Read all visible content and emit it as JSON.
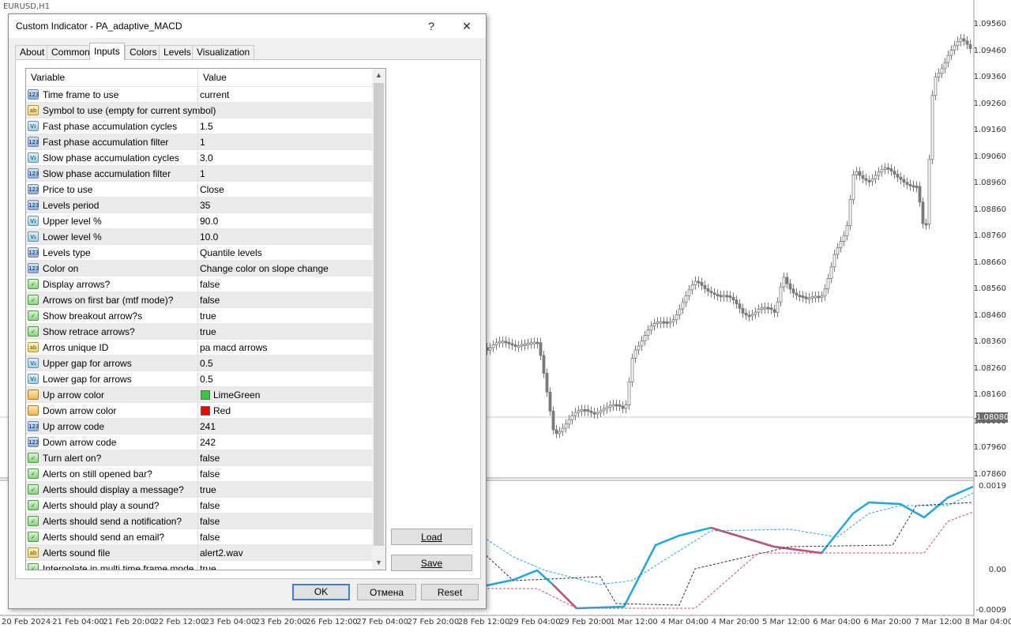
{
  "chart": {
    "symbol_label": "EURUSD,H1",
    "price_labels": [
      "1.09560",
      "1.09460",
      "1.09360",
      "1.09260",
      "1.09160",
      "1.09060",
      "1.08960",
      "1.08860",
      "1.08760",
      "1.08660",
      "1.08560",
      "1.08460",
      "1.08360",
      "1.08260",
      "1.08160",
      "1.08060",
      "1.07960",
      "1.07860"
    ],
    "current_price": "1.08080",
    "indicator_labels": [
      "0.0019",
      "0.00",
      "-0.0009"
    ],
    "time_labels": [
      "20 Feb 2024",
      "21 Feb 04:00",
      "21 Feb 20:00",
      "22 Feb 12:00",
      "23 Feb 04:00",
      "23 Feb 20:00",
      "26 Feb 12:00",
      "27 Feb 04:00",
      "27 Feb 20:00",
      "28 Feb 12:00",
      "29 Feb 04:00",
      "29 Feb 20:00",
      "1 Mar 12:00",
      "4 Mar 04:00",
      "4 Mar 20:00",
      "5 Mar 12:00",
      "6 Mar 04:00",
      "6 Mar 20:00",
      "7 Mar 12:00",
      "8 Mar 04:00"
    ],
    "colors": {
      "macd_up": "#1ea7e6",
      "macd_down": "#c0547a",
      "candles": "#7a7a7a"
    }
  },
  "dialog": {
    "title": "Custom Indicator - PA_adaptive_MACD",
    "help_glyph": "?",
    "close_glyph": "✕",
    "tabs": [
      "About",
      "Common",
      "Inputs",
      "Colors",
      "Levels",
      "Visualization"
    ],
    "active_tab": "Inputs",
    "grid": {
      "col_variable": "Variable",
      "col_value": "Value",
      "rows": [
        {
          "type": "int",
          "name": "Time frame to use",
          "value": "current"
        },
        {
          "type": "str",
          "name": "Symbol to use (empty for current symbol)",
          "value": ""
        },
        {
          "type": "dbl",
          "name": "Fast phase accumulation cycles",
          "value": "1.5"
        },
        {
          "type": "int",
          "name": "Fast phase accumulation filter",
          "value": "1"
        },
        {
          "type": "dbl",
          "name": "Slow phase accumulation cycles",
          "value": "3.0"
        },
        {
          "type": "int",
          "name": "Slow phase accumulation filter",
          "value": "1"
        },
        {
          "type": "int",
          "name": "Price to use",
          "value": "Close"
        },
        {
          "type": "int",
          "name": "Levels period",
          "value": "35"
        },
        {
          "type": "dbl",
          "name": "Upper level %",
          "value": "90.0"
        },
        {
          "type": "dbl",
          "name": "Lower level %",
          "value": "10.0"
        },
        {
          "type": "int",
          "name": "Levels type",
          "value": "Quantile levels"
        },
        {
          "type": "int",
          "name": "Color on",
          "value": "Change color on slope change"
        },
        {
          "type": "bool",
          "name": "Display arrows?",
          "value": "false"
        },
        {
          "type": "bool",
          "name": "Arrows on first bar (mtf mode)?",
          "value": "false"
        },
        {
          "type": "bool",
          "name": "Show breakout arrow?s",
          "value": "true"
        },
        {
          "type": "bool",
          "name": "Show retrace arrows?",
          "value": "true"
        },
        {
          "type": "str",
          "name": "Arros unique ID",
          "value": "pa macd arrows"
        },
        {
          "type": "dbl",
          "name": "Upper gap for arrows",
          "value": "0.5"
        },
        {
          "type": "dbl",
          "name": "Lower gap for arrows",
          "value": "0.5"
        },
        {
          "type": "clr",
          "name": "Up arrow color",
          "value": "LimeGreen",
          "swatch": "#32cd32"
        },
        {
          "type": "clr",
          "name": "Down arrow color",
          "value": "Red",
          "swatch": "#ff0000"
        },
        {
          "type": "int",
          "name": "Up arrow code",
          "value": "241"
        },
        {
          "type": "int",
          "name": "Down arrow code",
          "value": "242"
        },
        {
          "type": "bool",
          "name": "Turn alert on?",
          "value": "false"
        },
        {
          "type": "bool",
          "name": "Alerts on still opened bar?",
          "value": "false"
        },
        {
          "type": "bool",
          "name": "Alerts should display a message?",
          "value": "true"
        },
        {
          "type": "bool",
          "name": "Alerts should play a sound?",
          "value": "false"
        },
        {
          "type": "bool",
          "name": "Alerts should send a notification?",
          "value": "false"
        },
        {
          "type": "bool",
          "name": "Alerts should send an email?",
          "value": "false"
        },
        {
          "type": "str",
          "name": "Alerts sound file",
          "value": "alert2.wav"
        },
        {
          "type": "bool",
          "name": "Interpolate in multi time frame mode",
          "value": "true"
        }
      ]
    },
    "buttons": {
      "load": "Load",
      "save": "Save",
      "ok": "OK",
      "cancel": "Отмена",
      "reset": "Reset"
    }
  }
}
